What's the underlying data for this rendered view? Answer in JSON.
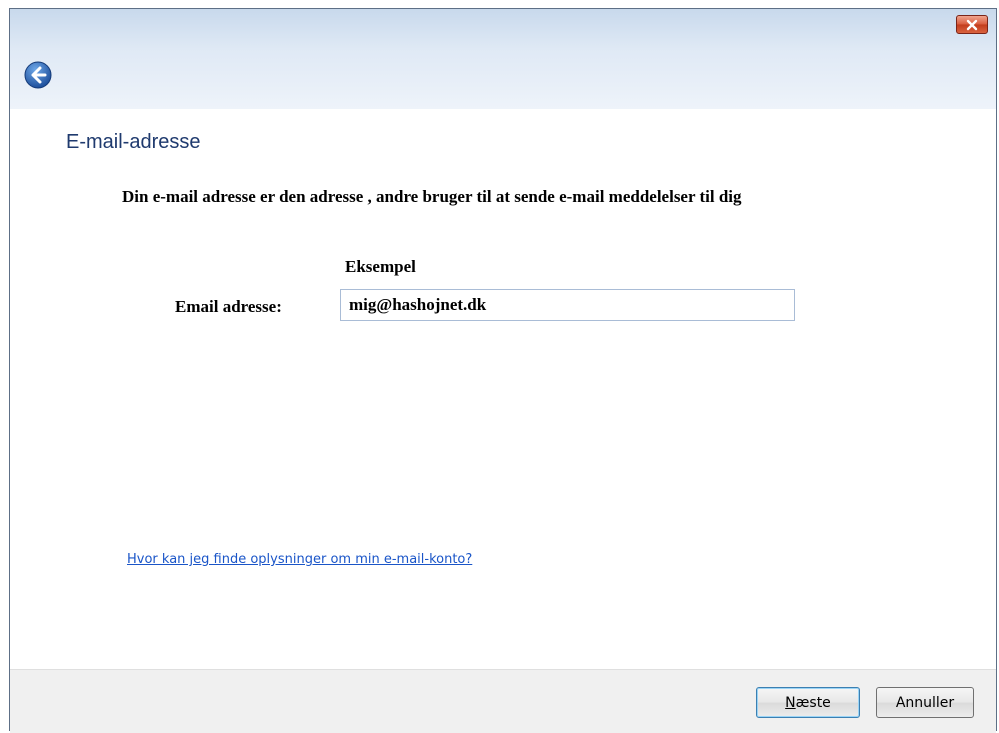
{
  "window": {
    "close_icon": "close-icon",
    "back_icon": "back-arrow-icon"
  },
  "page": {
    "heading": "E-mail-adresse",
    "description": "Din e-mail adresse er den adresse , andre bruger til at sende e-mail meddelelser til dig",
    "example_label": "Eksempel",
    "email_label": "Email adresse:",
    "email_value": "mig@hashojnet.dk",
    "help_link": "Hvor kan jeg finde oplysninger om min e-mail-konto?"
  },
  "footer": {
    "next_label": "Næste",
    "cancel_label": "Annuller"
  },
  "colors": {
    "heading": "#1f3a6e",
    "link": "#1a55c8",
    "close_button": "#c23b1b"
  }
}
